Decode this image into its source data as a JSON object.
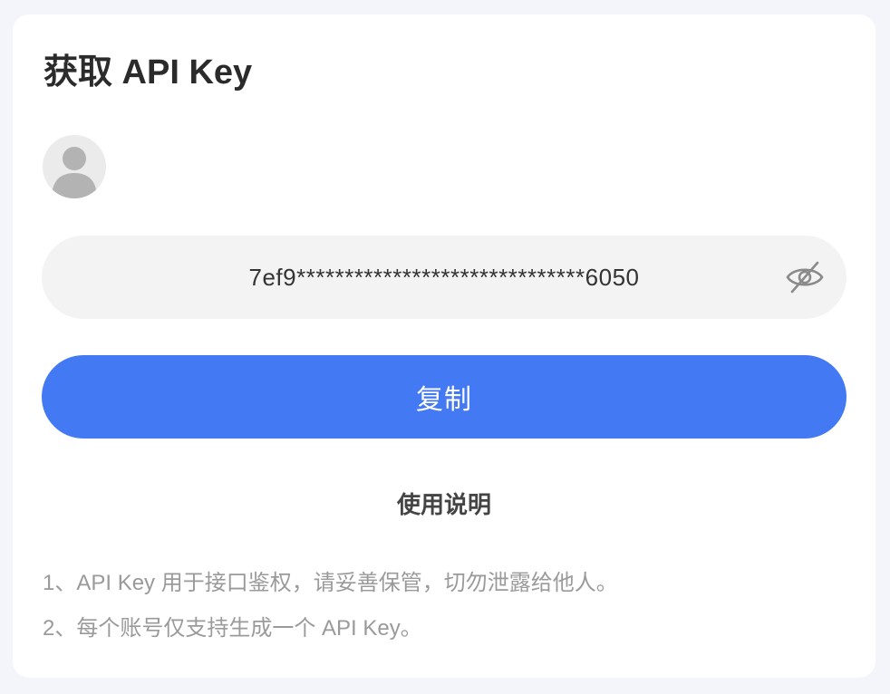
{
  "page": {
    "title": "获取 API Key",
    "avatar_icon": "user-avatar-icon"
  },
  "api_key": {
    "masked_value": "7ef9******************************6050",
    "visibility_icon": "eye-off-icon"
  },
  "copy_button": {
    "label": "复制",
    "color": "#4479f4"
  },
  "instructions": {
    "title": "使用说明",
    "items": [
      "1、API Key 用于接口鉴权，请妥善保管，切勿泄露给他人。",
      "2、每个账号仅支持生成一个 API Key。"
    ]
  }
}
